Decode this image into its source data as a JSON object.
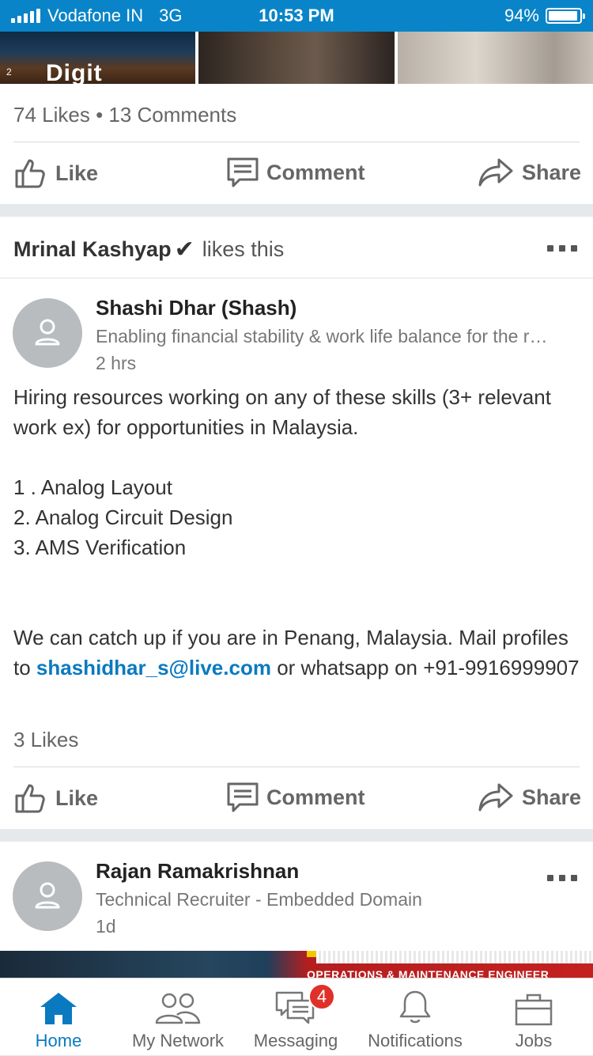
{
  "status_bar": {
    "carrier": "Vodafone IN",
    "network": "3G",
    "time": "10:53 PM",
    "battery": "94%",
    "battery_level": 0.94
  },
  "post1": {
    "photo_text": "Digit",
    "photo_num": "2",
    "counts": "74 Likes • 13 Comments"
  },
  "actions": {
    "like": "Like",
    "comment": "Comment",
    "share": "Share"
  },
  "post2": {
    "social_name": "Mrinal Kashyap",
    "social_check": "✔",
    "social_action": "likes this",
    "author": "Shashi Dhar (Shash)",
    "headline": "Enabling financial stability & work life balance for the r…",
    "time": "2 hrs",
    "body_p1": "Hiring resources working on any of these skills (3+ relevant work ex) for opportunities in Malaysia.",
    "list": [
      "1 . Analog Layout",
      "2.  Analog Circuit Design",
      "3.  AMS Verification"
    ],
    "body_p2_a": "We can catch up if you are in Penang, Malaysia. Mail profiles to",
    "email": "shashidhar_s@live.com",
    "body_p2_b": "or whatsapp on +91-9916999907",
    "counts": "3 Likes"
  },
  "post3": {
    "author": "Rajan Ramakrishnan",
    "headline": "Technical Recruiter - Embedded Domain",
    "time": "1d",
    "banner_text": "OPERATIONS & MAINTENANCE ENGINEER"
  },
  "tabs": [
    {
      "label": "Home",
      "icon": "home-icon",
      "active": true
    },
    {
      "label": "My Network",
      "icon": "people-icon"
    },
    {
      "label": "Messaging",
      "icon": "messaging-icon",
      "badge": "4"
    },
    {
      "label": "Notifications",
      "icon": "bell-icon"
    },
    {
      "label": "Jobs",
      "icon": "briefcase-icon"
    }
  ],
  "colors": {
    "accent": "#0a7ac0",
    "status_bar": "#0a84c8",
    "badge": "#e0302a"
  }
}
